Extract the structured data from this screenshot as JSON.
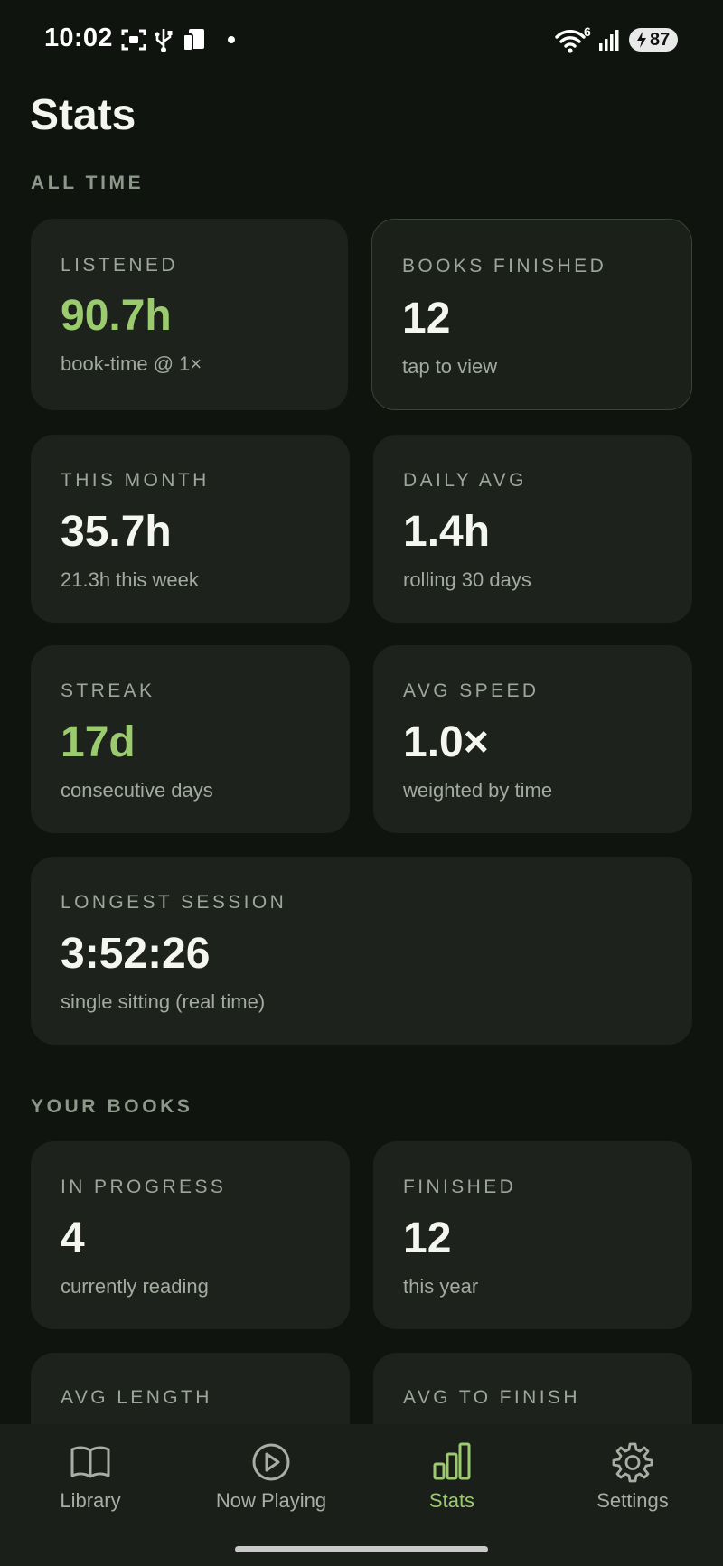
{
  "status_bar": {
    "time": "10:02",
    "battery": "87",
    "wifi_badge": "6"
  },
  "header": {
    "title": "Stats"
  },
  "sections": {
    "all_time": "ALL TIME",
    "your_books": "YOUR BOOKS"
  },
  "cards": {
    "listened": {
      "label": "LISTENED",
      "value": "90.7h",
      "sub": "book-time @ 1×"
    },
    "books_finished": {
      "label": "BOOKS FINISHED",
      "value": "12",
      "sub": "tap to view"
    },
    "this_month": {
      "label": "THIS MONTH",
      "value": "35.7h",
      "sub": "21.3h this week"
    },
    "daily_avg": {
      "label": "DAILY AVG",
      "value": "1.4h",
      "sub": "rolling 30 days"
    },
    "streak": {
      "label": "STREAK",
      "value": "17d",
      "sub": "consecutive days"
    },
    "avg_speed": {
      "label": "AVG SPEED",
      "value": "1.0×",
      "sub": "weighted by time"
    },
    "longest_session": {
      "label": "LONGEST SESSION",
      "value": "3:52:26",
      "sub": "single sitting (real time)"
    },
    "in_progress": {
      "label": "IN PROGRESS",
      "value": "4",
      "sub": "currently reading"
    },
    "finished": {
      "label": "FINISHED",
      "value": "12",
      "sub": "this year"
    },
    "avg_length": {
      "label": "AVG LENGTH"
    },
    "avg_to_finish": {
      "label": "AVG TO FINISH"
    }
  },
  "nav": {
    "items": [
      {
        "label": "Library",
        "icon": "book-icon"
      },
      {
        "label": "Now Playing",
        "icon": "play-circle-icon"
      },
      {
        "label": "Stats",
        "icon": "bar-chart-icon",
        "active": true
      },
      {
        "label": "Settings",
        "icon": "gear-icon"
      }
    ]
  },
  "colors": {
    "background": "#0f140f",
    "card": "#1d221c",
    "accent": "#9ccb6f",
    "muted_text": "#a3aaa0"
  }
}
